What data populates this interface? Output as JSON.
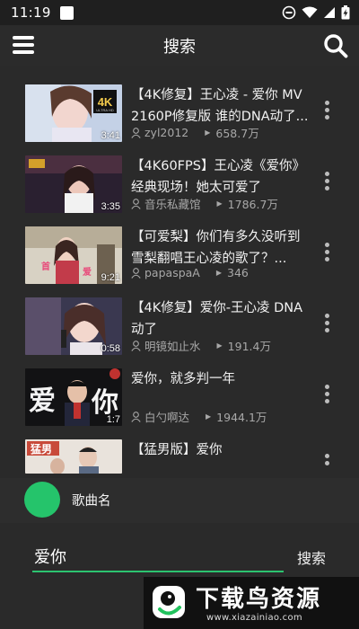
{
  "status": {
    "time": "11:19",
    "battery_icon": "battery-charging-icon",
    "wifi_icon": "wifi-icon",
    "signal_icon": "signal-icon",
    "dnd_icon": "do-not-disturb-icon"
  },
  "appbar": {
    "title": "搜索",
    "menu_icon": "menu-icon",
    "search_icon": "search-icon"
  },
  "results": [
    {
      "title": "【4K修复】王心凌 - 爱你 MV 2160P修复版 谁的DNA动了...",
      "duration": "3:41",
      "uploader": "zyl2012",
      "views": "658.7万",
      "thumb_colors": [
        "#b9c9e0",
        "#f1e7ee"
      ]
    },
    {
      "title": "【4K60FPS】王心凌《爱你》经典现场！她太可爱了",
      "duration": "3:35",
      "uploader": "音乐私藏馆",
      "views": "1786.7万",
      "thumb_colors": [
        "#2d2235",
        "#6a4257"
      ]
    },
    {
      "title": "【可爱梨】你们有多久没听到雪梨翻唱王心凌的歌了？...",
      "duration": "9:21",
      "uploader": "papaspaA",
      "views": "346",
      "thumb_colors": [
        "#c7b9a3",
        "#e2ded3"
      ]
    },
    {
      "title": "【4K修复】爱你-王心凌 DNA动了",
      "duration": "0:58",
      "uploader": "明镜如止水",
      "views": "191.4万",
      "thumb_colors": [
        "#3b3a52",
        "#d9c5c9"
      ]
    },
    {
      "title": "爱你，就多判一年",
      "duration": "1:7",
      "uploader": "白勺啊达",
      "views": "1944.1万",
      "thumb_colors": [
        "#0f0f12",
        "#b03a3a"
      ]
    },
    {
      "title": "【猛男版】爱你",
      "duration": "",
      "uploader": "",
      "views": "",
      "thumb_colors": [
        "#e8e0da",
        "#c84a3a"
      ]
    }
  ],
  "player": {
    "song_label": "歌曲名",
    "disc_color": "#25c46b"
  },
  "search": {
    "value": "爱你",
    "submit_label": "搜索",
    "accent": "#2cc470"
  },
  "watermark": {
    "title": "下载鸟资源",
    "url": "www.xiazainiao.com"
  }
}
